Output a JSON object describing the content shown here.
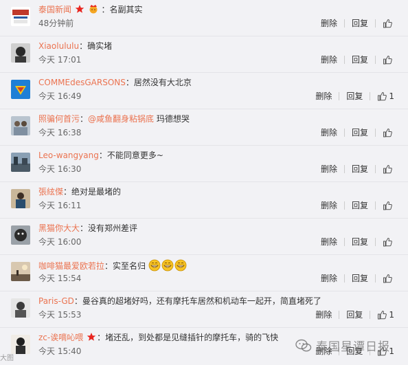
{
  "comments": [
    {
      "name": "泰国新闻",
      "text": "名副其实",
      "time": "48分钟前",
      "likes": "",
      "badges": true
    },
    {
      "name": "Xiaolululu",
      "text": "确实堵",
      "time": "今天 17:01",
      "likes": ""
    },
    {
      "name": "COMMEdesGARSONS",
      "text": "居然没有大北京",
      "time": "今天 16:49",
      "likes": "1"
    },
    {
      "name": "照骗何首污",
      "mention": "@咸鱼翻身粘锅底",
      "text": " 玛德想哭",
      "time": "今天 16:38",
      "likes": ""
    },
    {
      "name": "Leo-wangyang",
      "text": "不能同意更多~",
      "time": "今天 16:30",
      "likes": ""
    },
    {
      "name": "張絃傑",
      "text": "绝对是最堵的",
      "time": "今天 16:11",
      "likes": ""
    },
    {
      "name": "黑猫你大大",
      "text": "没有郑州差评",
      "time": "今天 16:00",
      "likes": ""
    },
    {
      "name": "咖啡猫最爱欧若拉",
      "text": "实至名归",
      "time": "今天 15:54",
      "likes": "",
      "emoji": 3
    },
    {
      "name": "Paris-GD",
      "text": "曼谷真的超堵好吗，还有摩托车居然和机动车一起开，简直堵死了",
      "time": "今天 15:53",
      "likes": "1"
    },
    {
      "name": "zc-诶嘀吣喂",
      "text": "堵还乱，到处都是见缝插针的摩托车，骑的飞快",
      "time": "今天 15:40",
      "likes": "1",
      "star": true
    }
  ],
  "labels": {
    "delete": "删除",
    "reply": "回复"
  },
  "watermark": {
    "text": "泰国星谭日报",
    "left": "大图"
  },
  "colors": {
    "name": "#eb7350",
    "bg": "#f2f2f5"
  },
  "icons": {
    "like": "thumbs-up-icon",
    "star": "red-star-icon",
    "wechat": "wechat-icon"
  }
}
